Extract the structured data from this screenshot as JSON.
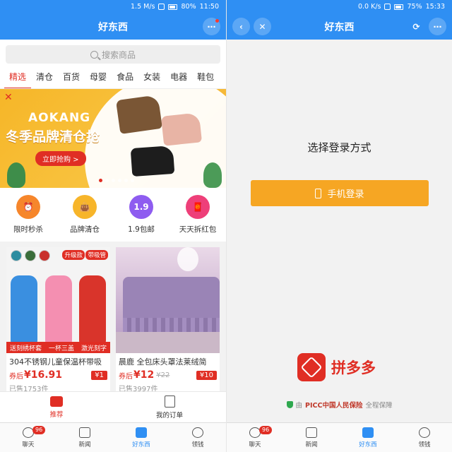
{
  "left": {
    "status": {
      "speed": "1.5 M/s",
      "battery": "80%",
      "time": "11:50"
    },
    "title": "好东西",
    "more_icon": "ellipsis-icon",
    "search": {
      "placeholder": "搜索商品"
    },
    "tabs": [
      "精选",
      "清仓",
      "百货",
      "母婴",
      "食品",
      "女装",
      "电器",
      "鞋包"
    ],
    "banner": {
      "brand": "AOKANG",
      "slogan": "冬季品牌清仓抢",
      "cta": "立即抢购 >"
    },
    "categories": [
      {
        "label": "限时秒杀",
        "icon": "alarm-clock-icon",
        "color": "#f6862b",
        "glyph": "⏰"
      },
      {
        "label": "品牌清仓",
        "icon": "shopping-bag-icon",
        "color": "#f7b52a",
        "glyph": "👜"
      },
      {
        "label": "1.9包邮",
        "icon": "price-1-9-icon",
        "color": "#8e5cf0",
        "glyph": "1.9"
      },
      {
        "label": "天天拆红包",
        "icon": "red-envelope-icon",
        "color": "#ee3f79",
        "glyph": "🧧"
      }
    ],
    "products": [
      {
        "name": "304不锈钢儿童保温杯带吸",
        "coupon_label": "券后",
        "price": "¥16.91",
        "old_price": "",
        "coupon": "¥1",
        "sold": "已售1753件",
        "tags": [
          "升级款",
          "带吸管"
        ],
        "strip": [
          "送刻绣杯套",
          "一杯三盖",
          "激光刻字"
        ]
      },
      {
        "name": "晨鹿 全包床头罩法莱绒简",
        "coupon_label": "券后",
        "price": "¥12",
        "old_price": "¥22",
        "coupon": "¥10",
        "sold": "已售3997件",
        "tags": [],
        "strip": []
      }
    ],
    "subnav": [
      {
        "label": "推荐",
        "icon": "home-icon",
        "active": true
      },
      {
        "label": "我的订单",
        "icon": "order-icon",
        "active": false
      }
    ],
    "tabbar": [
      {
        "label": "聊天",
        "icon": "chat-icon",
        "badge": "96",
        "active": false
      },
      {
        "label": "新闻",
        "icon": "news-icon",
        "badge": "",
        "active": false
      },
      {
        "label": "好东西",
        "icon": "shopping-bag-icon",
        "badge": "",
        "active": true
      },
      {
        "label": "领钱",
        "icon": "coin-icon",
        "badge": "",
        "active": false
      }
    ]
  },
  "right": {
    "status": {
      "speed": "0.0 K/s",
      "battery": "75%",
      "time": "15:33"
    },
    "title": "好东西",
    "login_title": "选择登录方式",
    "phone_login": "手机登录",
    "brand_name": "拼多多",
    "insurance": {
      "prefix": "由",
      "insurer": "PICC中国人民保险",
      "suffix": "全程保障"
    },
    "tabbar": [
      {
        "label": "聊天",
        "icon": "chat-icon",
        "badge": "96",
        "active": false
      },
      {
        "label": "新闻",
        "icon": "news-icon",
        "badge": "",
        "active": false
      },
      {
        "label": "好东西",
        "icon": "shopping-bag-icon",
        "badge": "",
        "active": true
      },
      {
        "label": "领钱",
        "icon": "coin-icon",
        "badge": "",
        "active": false
      }
    ]
  }
}
